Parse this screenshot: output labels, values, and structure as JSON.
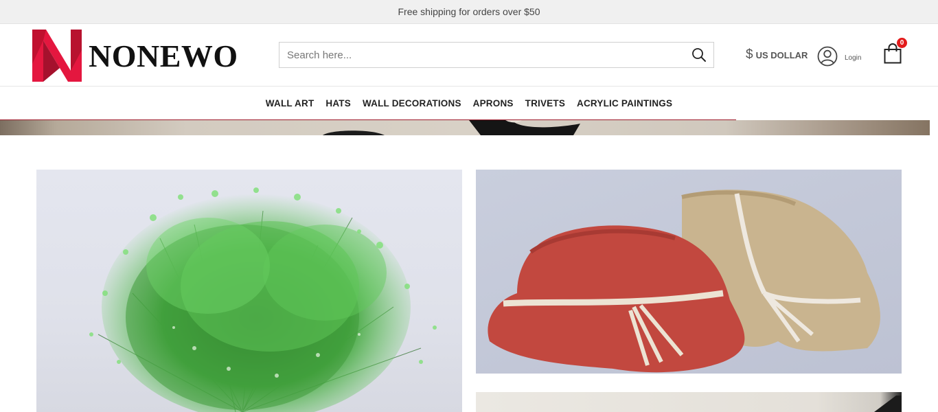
{
  "topbar": {
    "text": "Free shipping for orders over $50"
  },
  "header": {
    "logo_text": "NONEWO",
    "search": {
      "placeholder": "Search here..."
    },
    "currency": {
      "symbol": "$",
      "label": "US DOLLAR"
    },
    "account": {
      "login_label": "Login"
    },
    "cart": {
      "count": "0"
    }
  },
  "nav": {
    "items": [
      {
        "label": "WALL ART"
      },
      {
        "label": "HATS"
      },
      {
        "label": "WALL DECORATIONS"
      },
      {
        "label": "APRONS"
      },
      {
        "label": "TRIVETS"
      },
      {
        "label": "ACRYLIC PAINTINGS"
      }
    ]
  },
  "colors": {
    "accent": "#e31b1b",
    "logo_red": "#e4173f",
    "logo_dark_red": "#a5112d",
    "nav_underline": "#9e1c2c",
    "topbar_bg": "#f0f0f0"
  },
  "icons": {
    "search": "search-icon",
    "account": "user-circle-icon",
    "cart": "shopping-bag-icon",
    "currency": "dollar-icon"
  },
  "tiles": [
    {
      "subject": "green-flower-bouquet-image"
    },
    {
      "subject": "crochet-hats-image"
    },
    {
      "subject": "product-image"
    }
  ]
}
